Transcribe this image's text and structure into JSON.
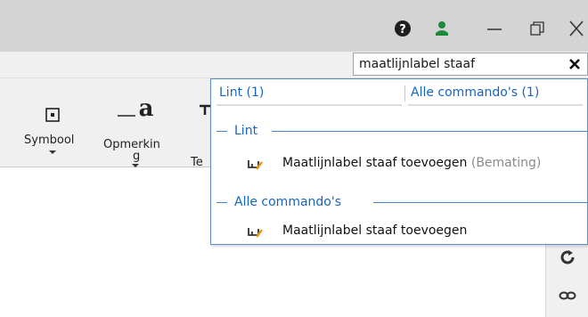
{
  "colors": {
    "accent": "#1565c0",
    "titlebar": "#d4d4d4",
    "ribbon": "#f0f0f0",
    "popup_border": "#5b8fc9",
    "user_icon": "#1e8a3c"
  },
  "titlebar": {
    "icons": [
      "help-icon",
      "user-icon",
      "minimize-icon",
      "restore-icon",
      "close-icon"
    ]
  },
  "search": {
    "value": "maatlijnlabel staaf",
    "clear_icon": "clear-search-icon"
  },
  "ribbon": {
    "buttons": [
      {
        "label": "Symbool",
        "icon": "symbol-icon"
      },
      {
        "label_line1": "Opmerkin",
        "label_line2": "g",
        "icon": "text-a-icon"
      },
      {
        "label": "Te",
        "icon": "text-icon"
      }
    ]
  },
  "popup": {
    "tabs": [
      {
        "label": "Lint (1)"
      },
      {
        "label": "Alle commando's (1)"
      }
    ],
    "sections": [
      {
        "title": "Lint",
        "results": [
          {
            "name": "Maatlijnlabel staaf toevoegen",
            "context": "(Bemating)",
            "icon": "rebar-dimension-label-icon"
          }
        ]
      },
      {
        "title": "Alle commando's",
        "results": [
          {
            "name": "Maatlijnlabel staaf toevoegen",
            "icon": "rebar-dimension-label-icon"
          }
        ]
      }
    ]
  },
  "sidepanel": {
    "icons": [
      "rotate-icon",
      "link-icon"
    ]
  }
}
